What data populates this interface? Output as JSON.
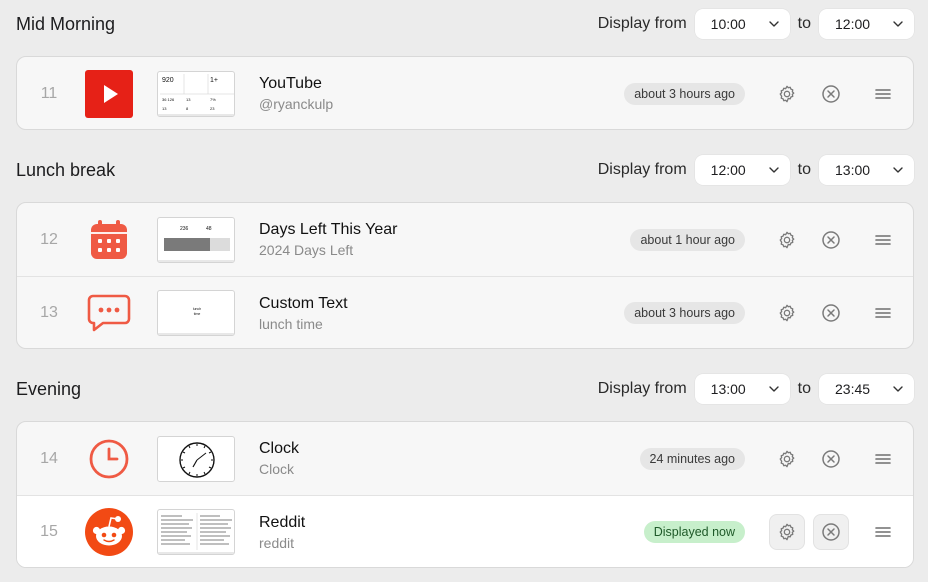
{
  "colors": {
    "accent": "#ef5a44",
    "youtube_red": "#e62117",
    "reddit_orange": "#f24a14",
    "live_badge_bg": "#c7efcb",
    "live_badge_text": "#1f5a29"
  },
  "sections": [
    {
      "title": "Mid Morning",
      "from_label": "Display from",
      "from": "10:00",
      "to_label": "to",
      "to": "12:00",
      "rows": [
        {
          "num": "11",
          "icon": "youtube-icon",
          "title": "YouTube",
          "subtitle": "@ryanckulp",
          "status": "about 3 hours ago",
          "live": false
        }
      ]
    },
    {
      "title": "Lunch break",
      "from_label": "Display from",
      "from": "12:00",
      "to_label": "to",
      "to": "13:00",
      "rows": [
        {
          "num": "12",
          "icon": "calendar-icon",
          "title": "Days Left This Year",
          "subtitle": "2024 Days Left",
          "status": "about 1 hour ago",
          "live": false
        },
        {
          "num": "13",
          "icon": "message-icon",
          "title": "Custom Text",
          "subtitle": "lunch time",
          "status": "about 3 hours ago",
          "live": false
        }
      ]
    },
    {
      "title": "Evening",
      "from_label": "Display from",
      "from": "13:00",
      "to_label": "to",
      "to": "23:45",
      "rows": [
        {
          "num": "14",
          "icon": "clock-icon",
          "title": "Clock",
          "subtitle": "Clock",
          "status": "24 minutes ago",
          "live": false
        },
        {
          "num": "15",
          "icon": "reddit-icon",
          "title": "Reddit",
          "subtitle": "reddit",
          "status": "Displayed now",
          "live": true
        }
      ]
    }
  ],
  "thumbs": {
    "youtube": {
      "subs": "920",
      "views": "1+",
      "a": "36 126",
      "b": "13",
      "c": "7%",
      "d": "13",
      "e": "8",
      "f": "23"
    },
    "days": {
      "left": "236",
      "right": "48"
    },
    "custom_text": {
      "line1": "lunch",
      "line2": "time"
    }
  }
}
